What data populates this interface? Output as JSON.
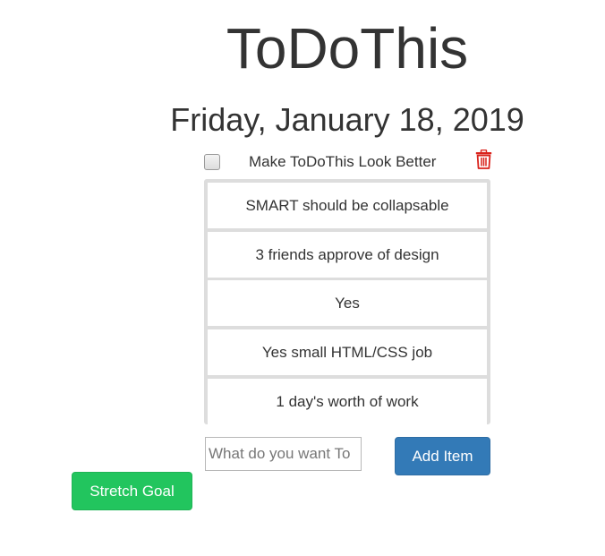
{
  "header": {
    "app_title": "ToDoThis",
    "date": "Friday, January 18, 2019"
  },
  "todo": {
    "label": "Make ToDoThis Look Better",
    "checked": false,
    "delete_icon": "trash-icon",
    "smart_items": [
      {
        "text": "SMART should be collapsable"
      },
      {
        "text": "3 friends approve of design"
      },
      {
        "text": "Yes"
      },
      {
        "text": "Yes small HTML/CSS job"
      },
      {
        "text": "1 day's worth of work"
      }
    ]
  },
  "form": {
    "input_placeholder": "What do you want To",
    "input_value": "",
    "add_label": "Add Item"
  },
  "actions": {
    "stretch_goal_label": "Stretch Goal"
  },
  "colors": {
    "add_button": "#337ab7",
    "stretch_button": "#22c55e",
    "trash_icon": "#d9221b"
  }
}
